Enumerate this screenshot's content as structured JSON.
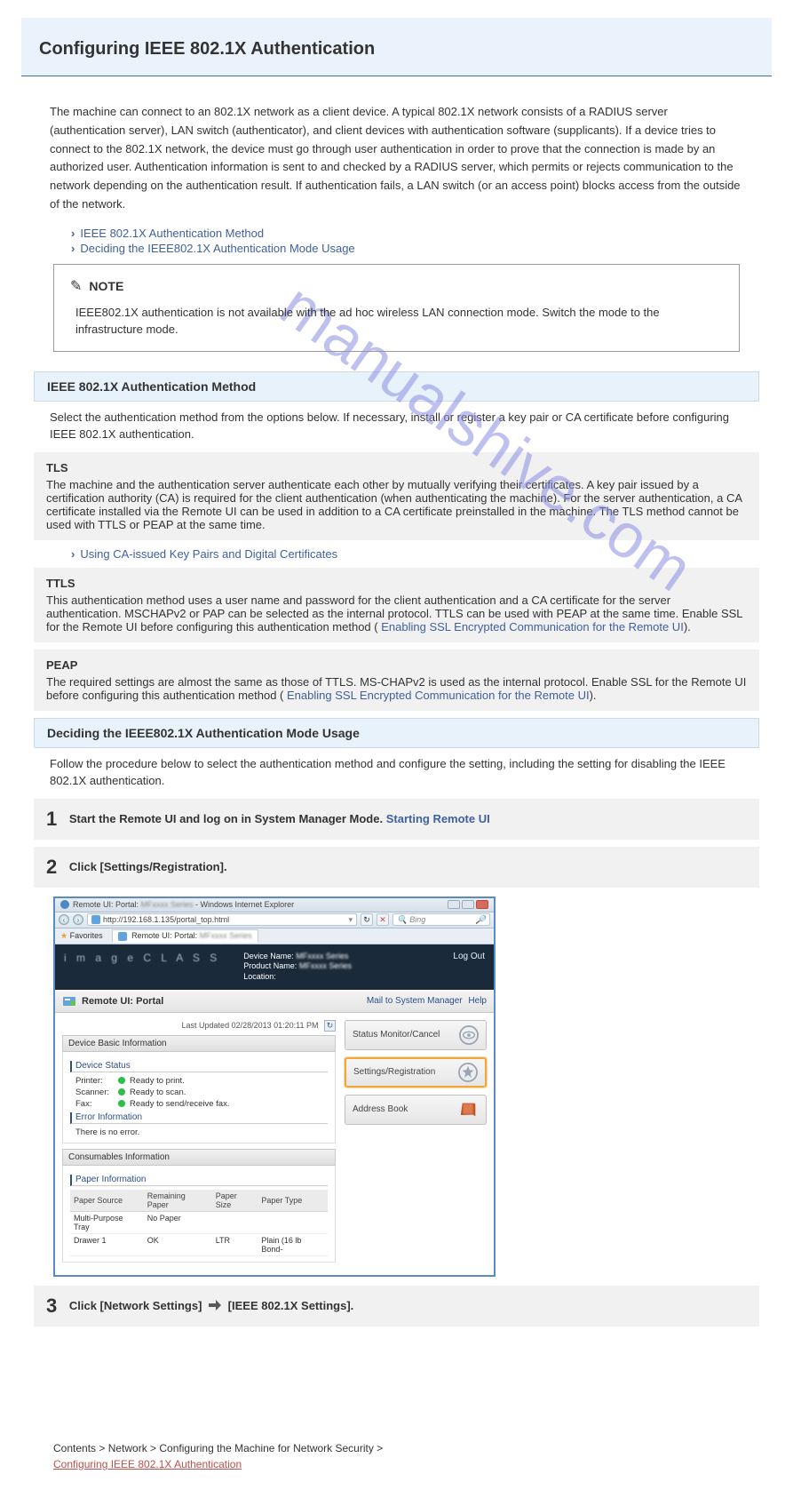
{
  "watermark_text": "manualshive.com",
  "title": "Configuring IEEE 802.1X Authentication",
  "intro": "The machine can connect to an 802.1X network as a client device. A typical 802.1X network consists of a RADIUS server (authentication server), LAN switch (authenticator), and client devices with authentication software (supplicants). If a device tries to connect to the 802.1X network, the device must go through user authentication in order to prove that the connection is made by an authorized user. Authentication information is sent to and checked by a RADIUS server, which permits or rejects communication to the network depending on the authentication result. If authentication fails, a LAN switch (or an access point) blocks access from the outside of the network.",
  "method_title": "IEEE 802.1X Authentication Method",
  "method_body": "Select the authentication method from the options below. If necessary, install or register a key pair or CA certificate before configuring IEEE 802.1X authentication.",
  "tls_title": "TLS",
  "tls_body": "The machine and the authentication server authenticate each other by mutually verifying their certificates. A key pair issued by a certification authority (CA) is required for the client authentication (when authenticating the machine). For the server authentication, a CA certificate installed via the Remote UI can be used in addition to a CA certificate preinstalled in the machine. The TLS method cannot be used with TTLS or PEAP at the same time.",
  "link_keys": "Using CA-issued Key Pairs and Digital Certificates",
  "ttls_title": "TTLS",
  "ttls_body": "This authentication method uses a user name and password for the client authentication and a CA certificate for the server authentication. MSCHAPv2 or PAP can be selected as the internal protocol. TTLS can be used with PEAP at the same time. Enable SSL for the Remote UI before configuring this authentication method (",
  "ttls_body2": ").",
  "link_ssl": "Enabling SSL Encrypted Communication for the Remote UI",
  "peap_title": "PEAP",
  "peap_body": "The required settings are almost the same as those of TTLS. MS-CHAPv2 is used as the internal protocol. Enable SSL for the Remote UI before configuring this authentication method (",
  "peap_body2": ").",
  "note_label": "NOTE",
  "note_text": "IEEE802.1X authentication is not available with the ad hoc wireless LAN connection mode. Switch the mode to the infrastructure mode.",
  "section_deciding": "Deciding the IEEE802.1X Authentication Mode Usage",
  "deciding_body": "Follow the procedure below to select the authentication method and configure the setting, including the setting for disabling the IEEE 802.1X authentication.",
  "step1_text_a": "Start the Remote UI and log on in System Manager Mode.",
  "step1_link": "Starting Remote UI",
  "step2_text": "Click [Settings/Registration].",
  "step3_text_a": "Click [Network Settings]",
  "step3_text_b": "[IEEE 802.1X Settings].",
  "screenshot": {
    "windowTitle": "Remote UI: Portal: ",
    "windowSuffix": " - Windows Internet Explorer",
    "url": "http://192.168.1.135/portal_top.html",
    "searchPlaceholder": "Bing",
    "favorites": "Favorites",
    "tabTitle": "Remote UI: Portal: ",
    "brand": "i m a g e C L A S S",
    "deviceNameLabel": "Device Name:",
    "productNameLabel": "Product Name:",
    "locationLabel": "Location:",
    "logout": "Log Out",
    "portalLabel": "Remote UI: Portal",
    "mailLink": "Mail to System Manager",
    "helpLink": "Help",
    "updated": "Last Updated 02/28/2013 01:20:11 PM",
    "basicInfo": "Device Basic Information",
    "deviceStatus": "Device Status",
    "printerLabel": "Printer:",
    "printerStatus": "Ready to print.",
    "scannerLabel": "Scanner:",
    "scannerStatus": "Ready to scan.",
    "faxLabel": "Fax:",
    "faxStatus": "Ready to send/receive fax.",
    "errorInfo": "Error Information",
    "errorBody": "There is no error.",
    "consumables": "Consumables Information",
    "paperInfo": "Paper Information",
    "thSource": "Paper Source",
    "thRemain": "Remaining Paper",
    "thSize": "Paper Size",
    "thType": "Paper Type",
    "row1Source": "Multi-Purpose Tray",
    "row1Remain": "No Paper",
    "row2Source": "Drawer 1",
    "row2Remain": "OK",
    "row2Size": "LTR",
    "row2Type": "Plain (16 lb Bond-",
    "btnStatus": "Status Monitor/Cancel",
    "btnSettings": "Settings/Registration",
    "btnAddress": "Address Book"
  },
  "footer_prefix": "Contents > Network > Configuring the Machine for Network Security >",
  "footer_link": "Configuring IEEE 802.1X Authentication"
}
